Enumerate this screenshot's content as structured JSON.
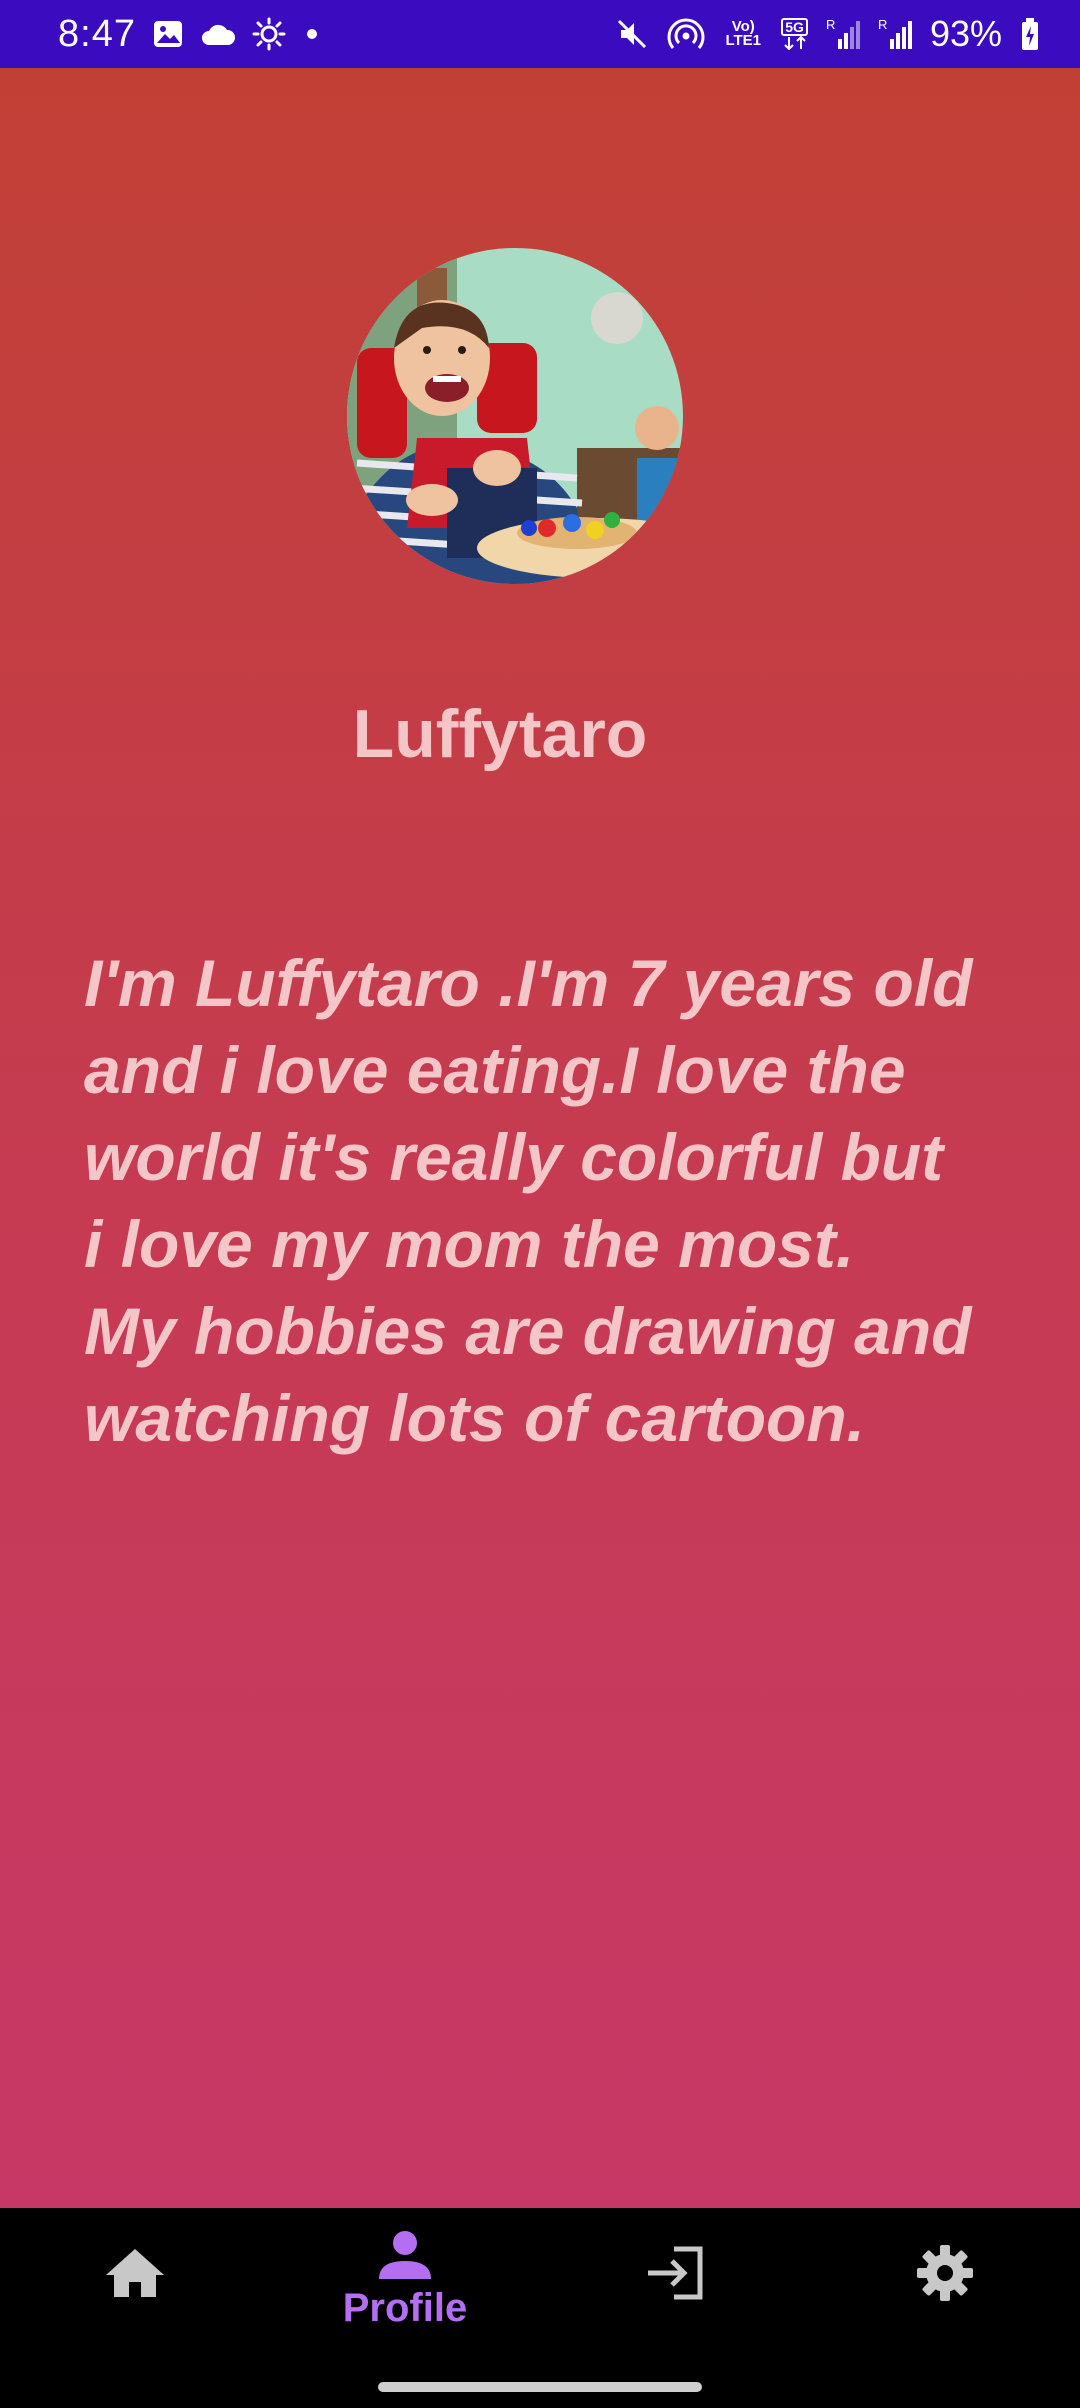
{
  "status_bar": {
    "time": "8:47",
    "volte_label": "Vo) LTE1",
    "network_label": "5G",
    "battery": "93%"
  },
  "profile": {
    "username": "Luffytaro",
    "bio": "I'm Luffytaro .I'm 7 years old\nand i love eating.I love the\nworld it's really colorful but\ni love my mom the most.\nMy hobbies are drawing and\nwatching lots of cartoon."
  },
  "bottom_nav": {
    "items": [
      {
        "icon": "home-icon",
        "label": ""
      },
      {
        "icon": "person-icon",
        "label": "Profile",
        "active": true
      },
      {
        "icon": "login-icon",
        "label": ""
      },
      {
        "icon": "gear-icon",
        "label": ""
      }
    ]
  },
  "colors": {
    "status_bar": "#3a0bbf",
    "text_pink": "#f4c6c8",
    "nav_active": "#b46ef2",
    "nav_inactive": "#c8c8c8"
  }
}
